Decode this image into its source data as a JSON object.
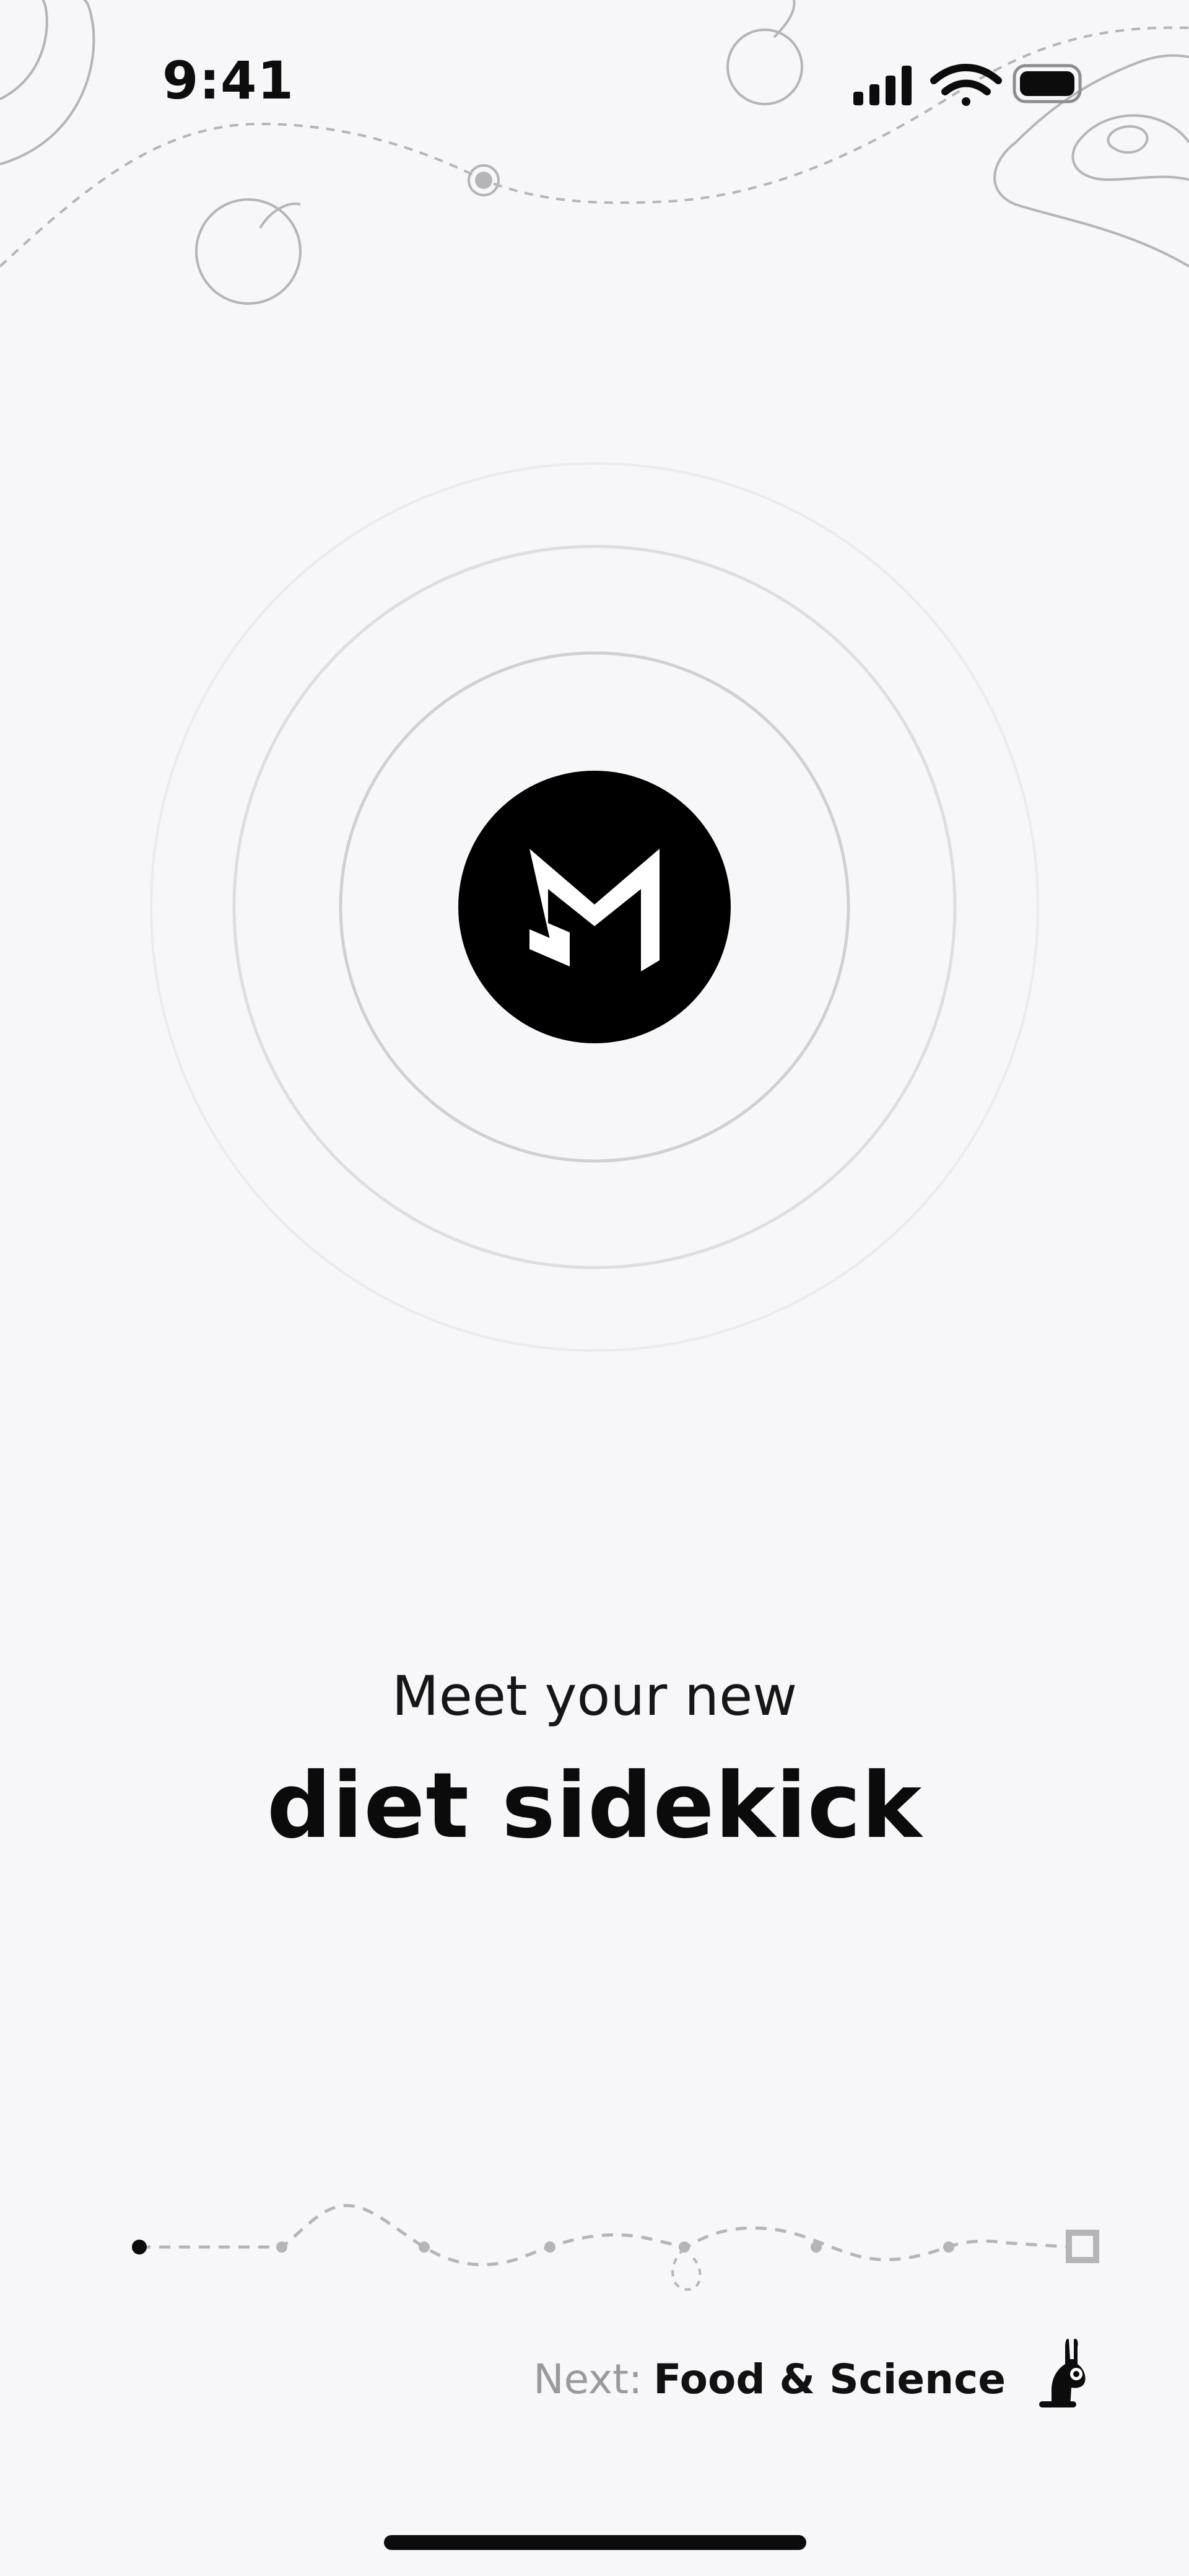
{
  "status_bar": {
    "time": "9:41",
    "icons": [
      "signal-icon",
      "wifi-icon",
      "battery-icon"
    ]
  },
  "brand": {
    "logo_icon": "m-logo-icon",
    "logo_bg": "#000000",
    "logo_fg": "#ffffff"
  },
  "headline": {
    "subtitle": "Meet your new",
    "title": "diet sidekick"
  },
  "progress": {
    "current_step": 1,
    "end_marker": "square-end-icon"
  },
  "next": {
    "prefix": "Next:",
    "title": "Food & Science",
    "icon": "mascot-icon"
  },
  "colors": {
    "background": "#f7f6f9",
    "text": "#0d0d0d",
    "muted": "#9a999e",
    "decoration": "#b5b4b8"
  }
}
